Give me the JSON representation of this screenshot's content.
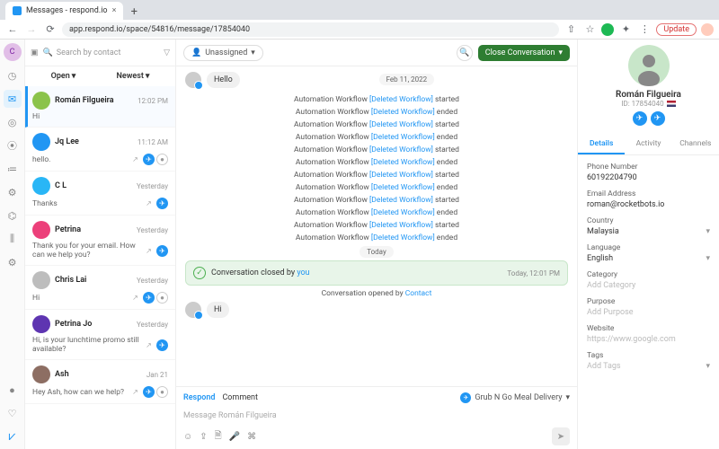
{
  "browser": {
    "tab_title": "Messages - respond.io",
    "url": "app.respond.io/space/54816/message/17854040",
    "update": "Update"
  },
  "search": {
    "placeholder": "Search by contact"
  },
  "filters": {
    "open": "Open",
    "newest": "Newest"
  },
  "conversations": [
    {
      "name": "Román Filgueira",
      "time": "12:02 PM",
      "preview": "Hi",
      "avatar_bg": "#8bc34a",
      "selected": true,
      "noext": true
    },
    {
      "name": "Jq Lee",
      "time": "11:12 AM",
      "preview": "hello.",
      "avatar_bg": "#2196f3",
      "extra": "wh"
    },
    {
      "name": "C L",
      "time": "Yesterday",
      "preview": "Thanks",
      "avatar_bg": "#29b6f6"
    },
    {
      "name": "Petrina",
      "time": "Yesterday",
      "preview": "Thank you for your email. How can we help you?",
      "avatar_bg": "#ec407a"
    },
    {
      "name": "Chris Lai",
      "time": "Yesterday",
      "preview": "Hi",
      "avatar_bg": "#bdbdbd",
      "extra": "wh"
    },
    {
      "name": "Petrina Jo",
      "time": "Yesterday",
      "preview": "Hi, is your lunchtime promo still available?",
      "avatar_bg": "#5e35b1"
    },
    {
      "name": "Ash",
      "time": "Jan 21",
      "preview": "Hey Ash, how can we help?",
      "avatar_bg": "#8d6e63",
      "extra": "wh"
    }
  ],
  "header": {
    "unassigned": "Unassigned",
    "close": "Close Conversation"
  },
  "chat": {
    "date": "Feb 11, 2022",
    "today": "Today",
    "hello": "Hello",
    "hi": "Hi",
    "wfprefix": "Automation Workflow ",
    "wflink": "[Deleted Workflow]",
    "workflows": [
      {
        "s": "started"
      },
      {
        "s": "ended"
      },
      {
        "s": "started"
      },
      {
        "s": "ended"
      },
      {
        "s": "started"
      },
      {
        "s": "ended"
      },
      {
        "s": "started"
      },
      {
        "s": "ended"
      },
      {
        "s": "started"
      },
      {
        "s": "ended"
      },
      {
        "s": "started"
      },
      {
        "s": "ended"
      }
    ],
    "closed_pre": "Conversation closed by ",
    "closed_by": "you",
    "closed_time": "Today, 12:01 PM",
    "opened_pre": "Conversation opened by ",
    "opened_by": "Contact"
  },
  "composer": {
    "respond": "Respond",
    "comment": "Comment",
    "channel": "Grub N Go Meal Delivery",
    "placeholder": "Message Román Filgueira"
  },
  "panel": {
    "name": "Román Filgueira",
    "id_label": "ID: 17854040",
    "tabs": {
      "details": "Details",
      "activity": "Activity",
      "channels": "Channels"
    },
    "fields": [
      {
        "label": "Phone Number",
        "value": "60192204790"
      },
      {
        "label": "Email Address",
        "value": "roman@rocketbots.io"
      },
      {
        "label": "Country",
        "value": "Malaysia",
        "dropdown": true
      },
      {
        "label": "Language",
        "value": "English",
        "dropdown": true
      },
      {
        "label": "Category",
        "value": "Add Category",
        "ph": true
      },
      {
        "label": "Purpose",
        "value": "Add Purpose",
        "ph": true
      },
      {
        "label": "Website",
        "value": "https://www.google.com",
        "ph": true
      },
      {
        "label": "Tags",
        "value": "Add Tags",
        "ph": true,
        "dropdown": true
      }
    ]
  }
}
